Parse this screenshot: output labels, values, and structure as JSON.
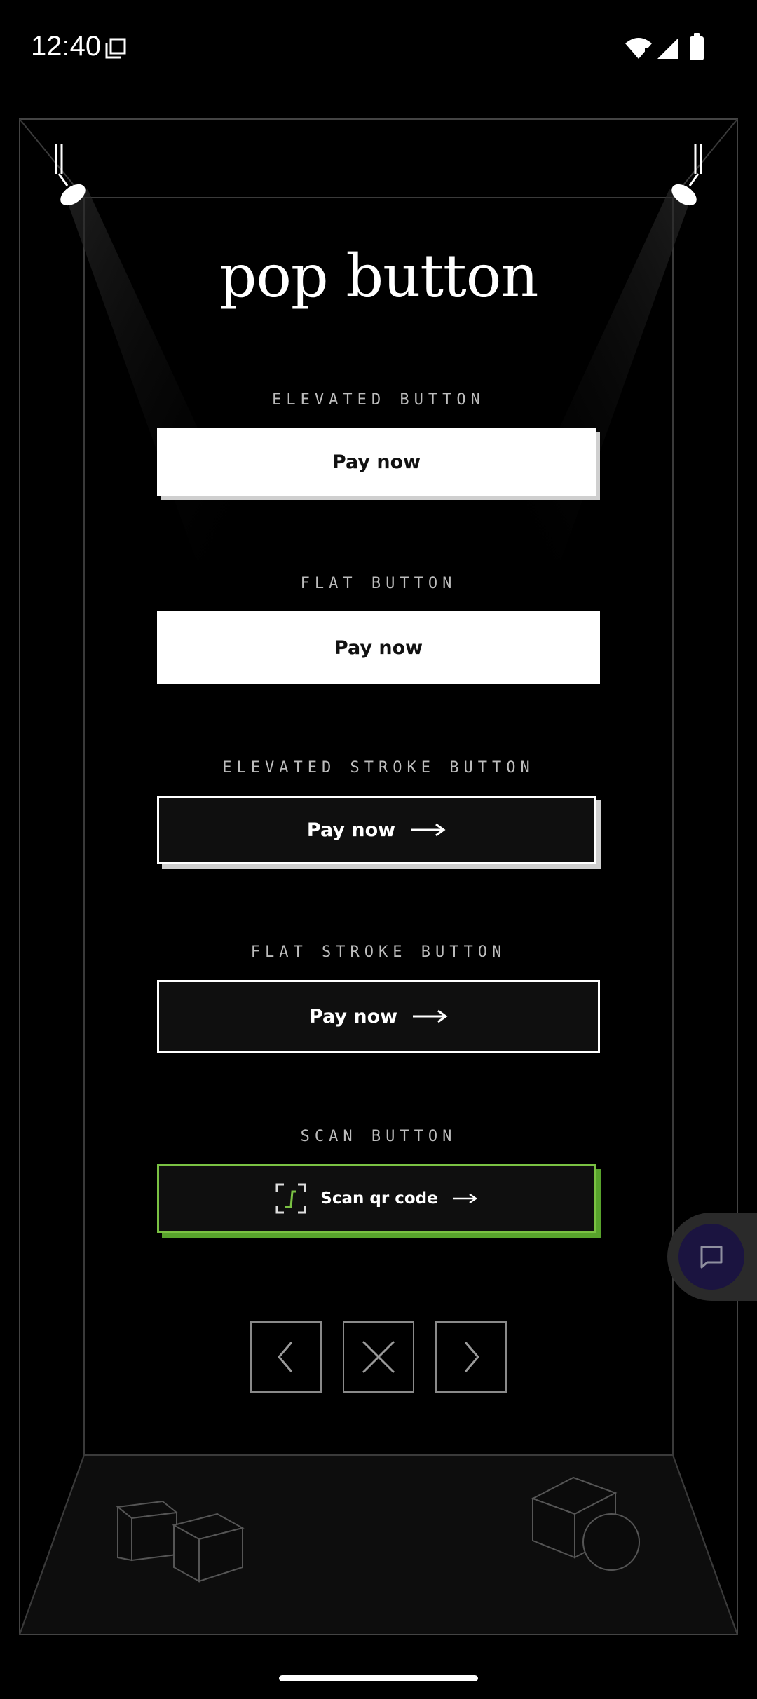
{
  "status_bar": {
    "time": "12:40"
  },
  "title": "pop button",
  "sections": [
    {
      "label": "ELEVATED BUTTON",
      "button": "Pay now"
    },
    {
      "label": "FLAT BUTTON",
      "button": "Pay now"
    },
    {
      "label": "ELEVATED STROKE BUTTON",
      "button": "Pay now"
    },
    {
      "label": "FLAT STROKE BUTTON",
      "button": "Pay now"
    },
    {
      "label": "SCAN BUTTON",
      "button": "Scan qr code"
    }
  ],
  "nav": {
    "prev_icon": "chevron-left-icon",
    "close_icon": "close-icon",
    "next_icon": "chevron-right-icon"
  },
  "colors": {
    "accent_green": "#7ac143",
    "background": "#000000",
    "chat_bubble": "#1b1440"
  }
}
